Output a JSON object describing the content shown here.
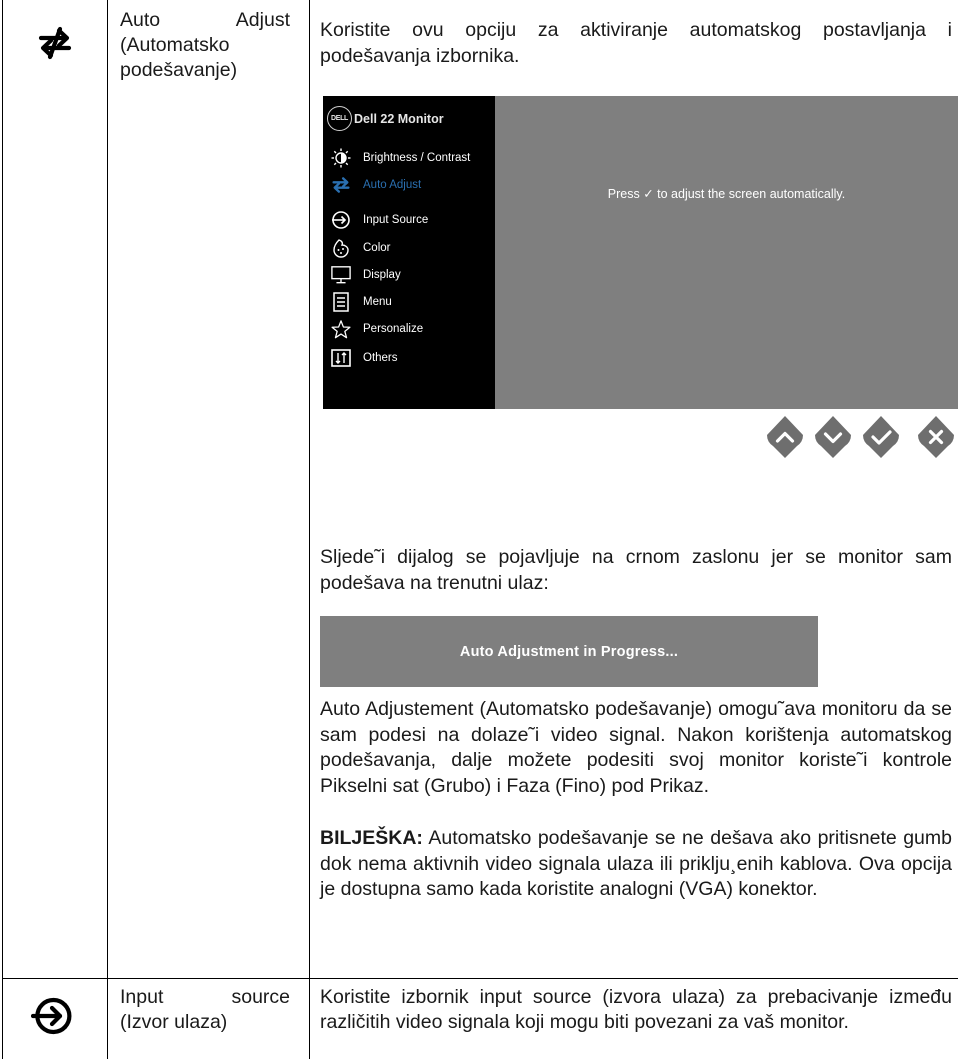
{
  "row_auto_adjust": {
    "icon": "auto-adjust-arrows-icon",
    "name_line1_a": "Auto",
    "name_line1_b": "Adjust",
    "name_line2": "(Automatsko",
    "name_line3": "podešavanje)",
    "intro": "Koristite ovu opciju za aktiviranje automatskog postavljanja i podešavanja izbornika.",
    "osd": {
      "logo": "DELL",
      "title": "Dell 22 Monitor",
      "items": [
        {
          "label": "Brightness / Contrast",
          "icon": "brightness-icon"
        },
        {
          "label": "Auto Adjust",
          "icon": "auto-adjust-icon",
          "active": true
        },
        {
          "label": "Input Source",
          "icon": "input-source-icon"
        },
        {
          "label": "Color",
          "icon": "color-icon"
        },
        {
          "label": "Display",
          "icon": "display-icon"
        },
        {
          "label": "Menu",
          "icon": "menu-icon"
        },
        {
          "label": "Personalize",
          "icon": "star-icon"
        },
        {
          "label": "Others",
          "icon": "others-icon"
        }
      ],
      "message": "Press ✓ to adjust the screen automatically.",
      "buttons": [
        "up-button",
        "down-button",
        "check-button",
        "close-button"
      ],
      "accent": "#2a6fb0",
      "menu_bg": "#000000",
      "panel_bg": "#7f7f7f"
    },
    "dialog_intro": "Sljede˜i dijalog se pojavljuje na crnom zaslonu jer se monitor sam podešava na trenutni ulaz:",
    "progress_text": "Auto Adjustment in Progress...",
    "body": "Auto Adjustement (Automatsko podešavanje)  omogu˜ava monitoru da se sam podesi na dolaze˜i video signal. Nakon korištenja automatskog podešavanja, dalje možete podesiti svoj monitor koriste˜i kontrole Pikselni sat (Grubo) i Faza (Fino) pod Prikaz.",
    "note_label": "BILJEŠKA:",
    "note_text": " Automatsko podešavanje se ne dešava ako pritisnete gumb dok nema aktivnih video signala ulaza ili priklju¸enih kablova. Ova opcija je dostupna samo kada koristite analogni (VGA) konektor."
  },
  "row_input_source": {
    "icon": "input-source-icon",
    "name_line1_a": "Input",
    "name_line1_b": "source",
    "name_line2": "(Izvor ulaza)",
    "desc": "Koristite izbornik  input source (izvora ulaza)  za prebacivanje između različitih video signala koji mogu biti povezani za vaš monitor."
  }
}
